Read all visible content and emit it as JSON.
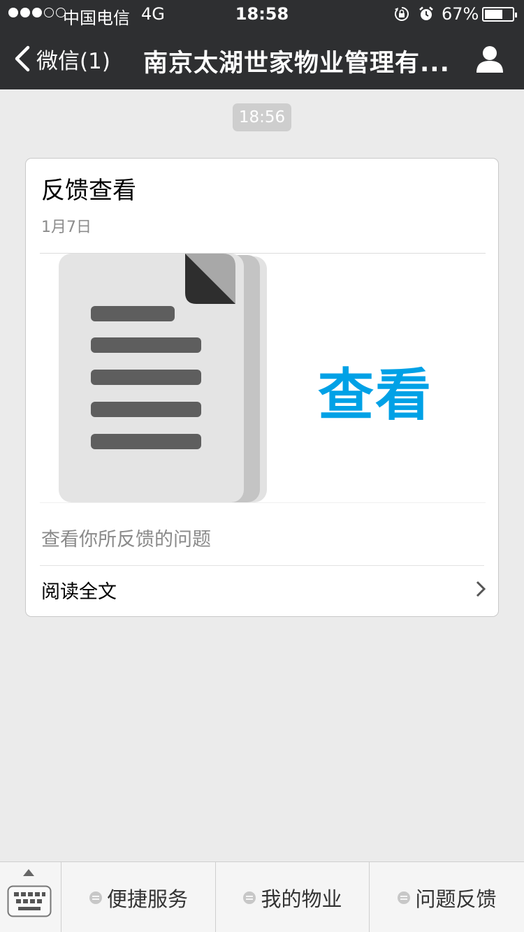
{
  "status_bar": {
    "signal_strength": "3/5",
    "carrier": "中国电信",
    "network": "4G",
    "time": "18:58",
    "battery_percent": "67%",
    "battery_level": 0.67
  },
  "nav": {
    "back_label": "微信(1)",
    "title": "南京太湖世家物业管理有..."
  },
  "chat": {
    "timestamp": "18:56",
    "article": {
      "title": "反馈查看",
      "date": "1月7日",
      "cover_text": "查看",
      "digest": "查看你所反馈的问题",
      "read_more": "阅读全文"
    }
  },
  "bottom_menu": {
    "items": [
      {
        "label": "便捷服务"
      },
      {
        "label": "我的物业"
      },
      {
        "label": "问题反馈"
      }
    ]
  },
  "colors": {
    "bar_background": "#2e2f31",
    "page_background": "#ebebeb",
    "cover_accent": "#00a1e6"
  },
  "icons": [
    "signal-dots-icon",
    "rotation-lock-icon",
    "alarm-icon",
    "battery-icon",
    "back-chevron-icon",
    "profile-icon",
    "document-icon",
    "chevron-right-icon",
    "keyboard-icon",
    "menu-dot-icon"
  ]
}
